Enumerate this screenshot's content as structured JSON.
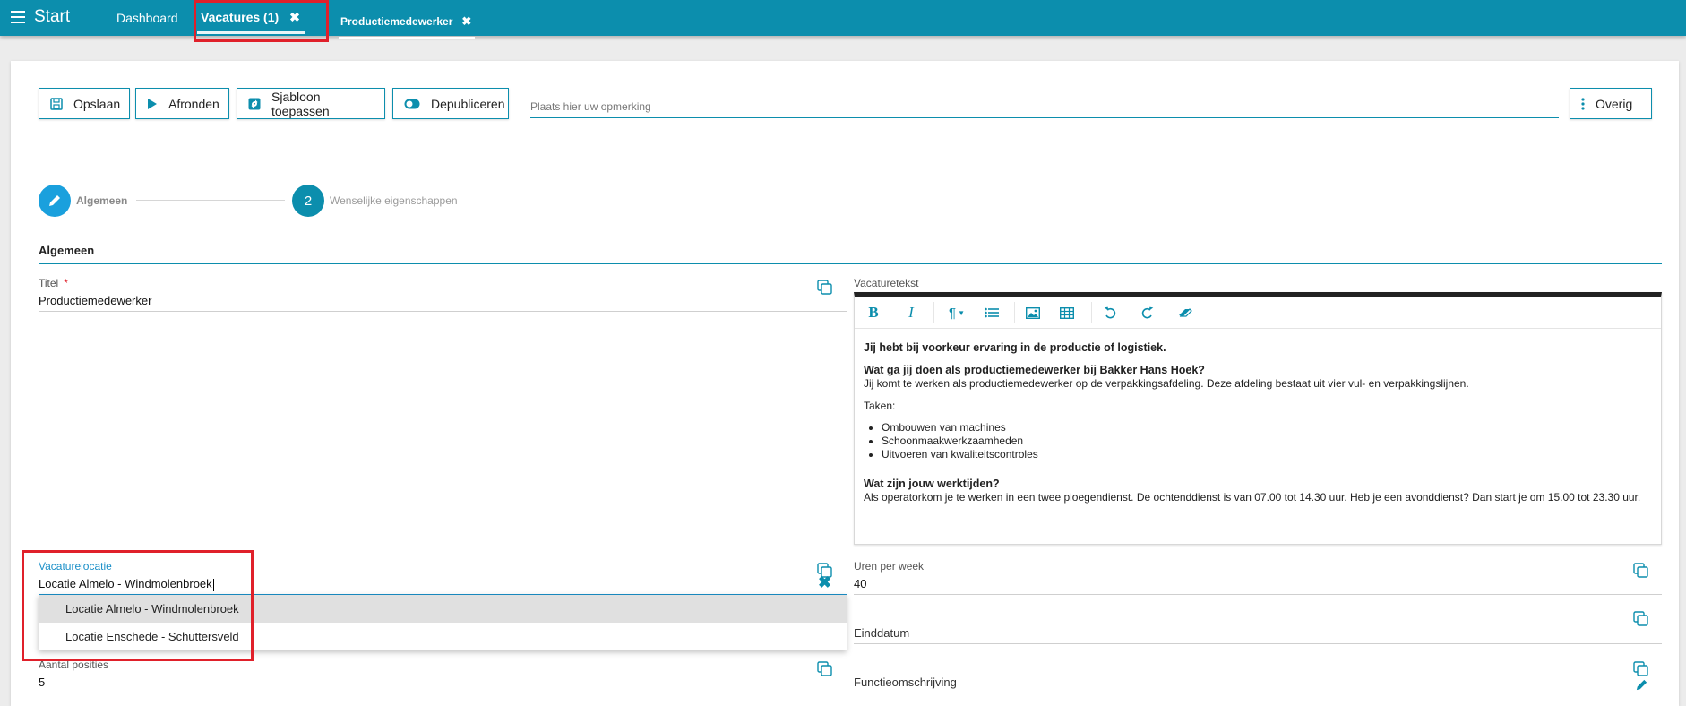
{
  "topbar": {
    "menu_label": "Start",
    "tabs": [
      {
        "label": "Dashboard"
      },
      {
        "label": "Vacatures (1)",
        "close": "✖"
      },
      {
        "label": "Productiemedewerker",
        "close": "✖"
      }
    ]
  },
  "toolbar": {
    "save": "Opslaan",
    "finish": "Afronden",
    "template": "Sjabloon toepassen",
    "depublish": "Depubliceren",
    "remark_placeholder": "Plaats hier uw opmerking",
    "more": "Overig"
  },
  "stepper": {
    "step1": "Algemeen",
    "step2_number": "2",
    "step2": "Wenselijke eigenschappen"
  },
  "section": {
    "title": "Algemeen"
  },
  "fields": {
    "title_label": "Titel",
    "title_required": "*",
    "title_value": "Productiemedewerker",
    "vacancy_text_label": "Vacaturetekst",
    "location_label": "Vacaturelocatie",
    "location_value": "Locatie Almelo - Windmolenbroek",
    "hours_label": "Uren per week",
    "hours_value": "40",
    "end_date_label": "Einddatum",
    "positions_label": "Aantal posities",
    "positions_value": "5",
    "function_desc_label": "Functieomschrijving"
  },
  "editor": {
    "p1": "Jij hebt bij voorkeur ervaring in de productie of logistiek.",
    "h2": "Wat ga jij doen als productiemedewerker bij Bakker Hans Hoek?",
    "p2": "Jij komt te werken als productiemedewerker op de verpakkingsafdeling. Deze afdeling bestaat uit vier vul- en verpakkingslijnen.",
    "p3": "Taken:",
    "list": [
      "Ombouwen van machines",
      "Schoonmaakwerkzaamheden",
      "Uitvoeren van kwaliteitscontroles"
    ],
    "h3": "Wat zijn jouw werktijden?",
    "p4": "Als operatorkom je te werken in een twee ploegendienst. De ochtenddienst is van 07.00 tot 14.30 uur. Heb je een avonddienst? Dan start je om 15.00 tot 23.30 uur."
  },
  "dropdown": {
    "options": [
      "Locatie Almelo - Windmolenbroek",
      "Locatie Enschede - Schuttersveld"
    ]
  },
  "colors": {
    "primary": "#0c8ead",
    "highlight_box": "#e0202a"
  }
}
